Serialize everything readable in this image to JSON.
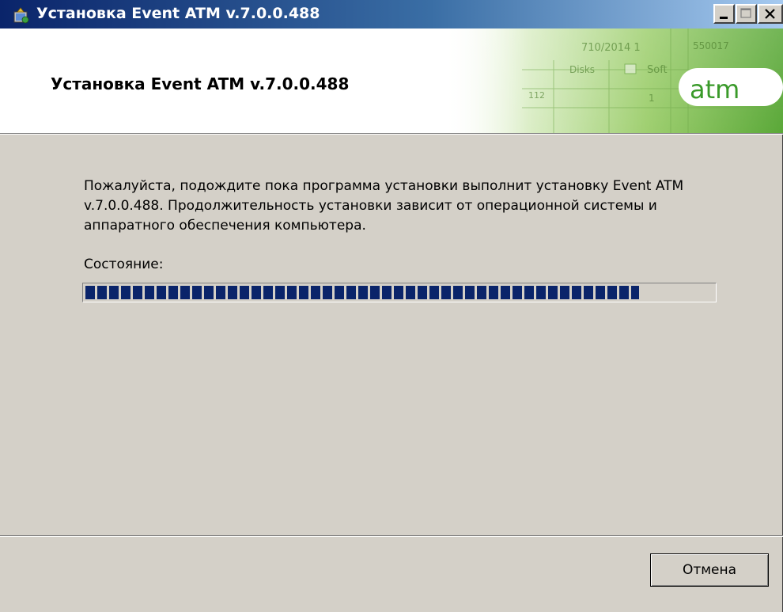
{
  "window": {
    "title": "Установка Event ATM v.7.0.0.488",
    "controls": [
      "minimize-icon",
      "maximize-icon",
      "close-icon"
    ]
  },
  "banner": {
    "title": "Установка Event ATM v.7.0.0.488",
    "logo_text": "atm",
    "background_fragments": [
      "710/2014 1",
      "550017",
      "Disks",
      "Soft",
      "112",
      "1"
    ]
  },
  "body": {
    "description": "Пожалуйста, подождите пока программа установки выполнит установку Event ATM v.7.0.0.488. Продолжительность установки зависит от операционной системы и аппаратного обеспечения компьютера.",
    "status_label": "Состояние:",
    "progress_fraction": 0.88
  },
  "footer": {
    "cancel_label": "Отмена"
  },
  "colors": {
    "titlebar_start": "#0a246a",
    "titlebar_end": "#a6caf0",
    "progress_fill": "#0a246a",
    "dialog_bg": "#d4d0c8",
    "logo_green": "#3a9a2a"
  }
}
